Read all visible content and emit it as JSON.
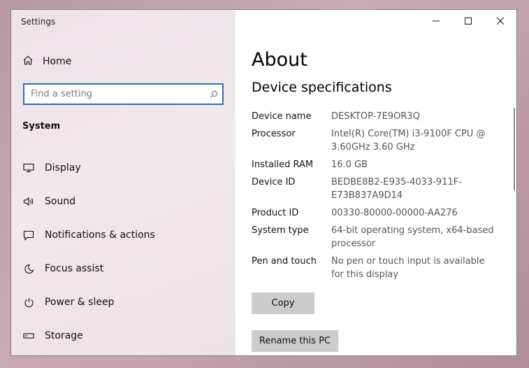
{
  "window": {
    "title": "Settings"
  },
  "sidebar": {
    "home_label": "Home",
    "search_placeholder": "Find a setting",
    "section_title": "System",
    "items": [
      {
        "label": "Display",
        "icon": "monitor-icon"
      },
      {
        "label": "Sound",
        "icon": "speaker-icon"
      },
      {
        "label": "Notifications & actions",
        "icon": "notification-icon"
      },
      {
        "label": "Focus assist",
        "icon": "moon-icon"
      },
      {
        "label": "Power & sleep",
        "icon": "power-icon"
      },
      {
        "label": "Storage",
        "icon": "storage-icon"
      }
    ]
  },
  "content": {
    "title": "About",
    "subtitle": "Device specifications",
    "specs": [
      {
        "key": "Device name",
        "value": "DESKTOP-7E9OR3Q"
      },
      {
        "key": "Processor",
        "value": "Intel(R) Core(TM) i3-9100F CPU @ 3.60GHz   3.60 GHz"
      },
      {
        "key": "Installed RAM",
        "value": "16.0 GB"
      },
      {
        "key": "Device ID",
        "value": "BEDBE8B2-E935-4033-911F-E73B837A9D14"
      },
      {
        "key": "Product ID",
        "value": "00330-80000-00000-AA276"
      },
      {
        "key": "System type",
        "value": "64-bit operating system, x64-based processor"
      },
      {
        "key": "Pen and touch",
        "value": "No pen or touch input is available for this display"
      }
    ],
    "copy_label": "Copy",
    "rename_label": "Rename this PC"
  }
}
